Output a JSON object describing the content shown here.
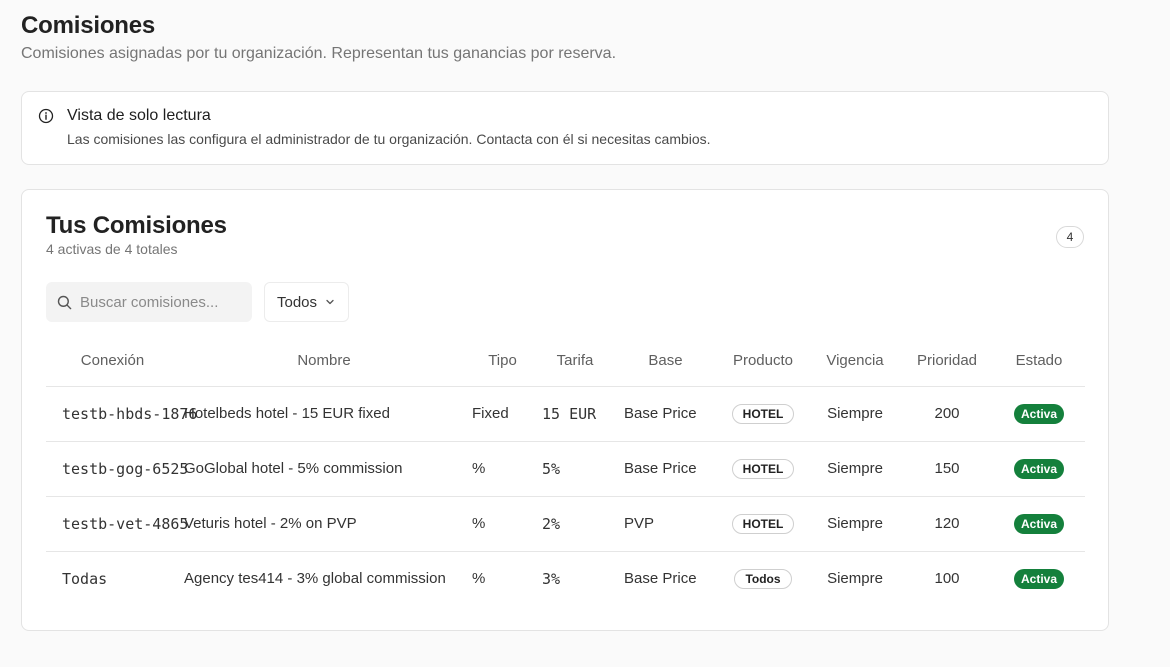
{
  "header": {
    "title": "Comisiones",
    "subtitle": "Comisiones asignadas por tu organización. Representan tus ganancias por reserva."
  },
  "notice": {
    "icon": "info-icon",
    "title": "Vista de solo lectura",
    "text": "Las comisiones las configura el administrador de tu organización. Contacta con él si necesitas cambios."
  },
  "card": {
    "title": "Tus Comisiones",
    "subtitle": "4 activas de 4 totales",
    "count": "4",
    "search": {
      "placeholder": "Buscar comisiones...",
      "value": "",
      "icon": "search-icon"
    },
    "filter": {
      "value": "Todos",
      "icon": "chevron-down-icon"
    }
  },
  "table": {
    "columns": [
      "Conexión",
      "Nombre",
      "Tipo",
      "Tarifa",
      "Base",
      "Producto",
      "Vigencia",
      "Prioridad",
      "Estado"
    ],
    "rows": [
      {
        "conexion": "testb-hbds-1876",
        "nombre": "Hotelbeds hotel - 15 EUR fixed",
        "tipo": "Fixed",
        "tarifa": "15 EUR",
        "base": "Base Price",
        "producto": "HOTEL",
        "vigencia": "Siempre",
        "prioridad": "200",
        "estado": "Activa"
      },
      {
        "conexion": "testb-gog-6525",
        "nombre": "GoGlobal hotel - 5% commission",
        "tipo": "%",
        "tarifa": "5%",
        "base": "Base Price",
        "producto": "HOTEL",
        "vigencia": "Siempre",
        "prioridad": "150",
        "estado": "Activa"
      },
      {
        "conexion": "testb-vet-4865",
        "nombre": "Veturis hotel - 2% on PVP",
        "tipo": "%",
        "tarifa": "2%",
        "base": "PVP",
        "producto": "HOTEL",
        "vigencia": "Siempre",
        "prioridad": "120",
        "estado": "Activa"
      },
      {
        "conexion": "Todas",
        "nombre": "Agency tes414 - 3% global commission",
        "tipo": "%",
        "tarifa": "3%",
        "base": "Base Price",
        "producto": "Todos",
        "vigencia": "Siempre",
        "prioridad": "100",
        "estado": "Activa"
      }
    ]
  },
  "colors": {
    "active_badge": "#14803c",
    "page_background": "#fafafa",
    "border": "#e3e3e3"
  }
}
